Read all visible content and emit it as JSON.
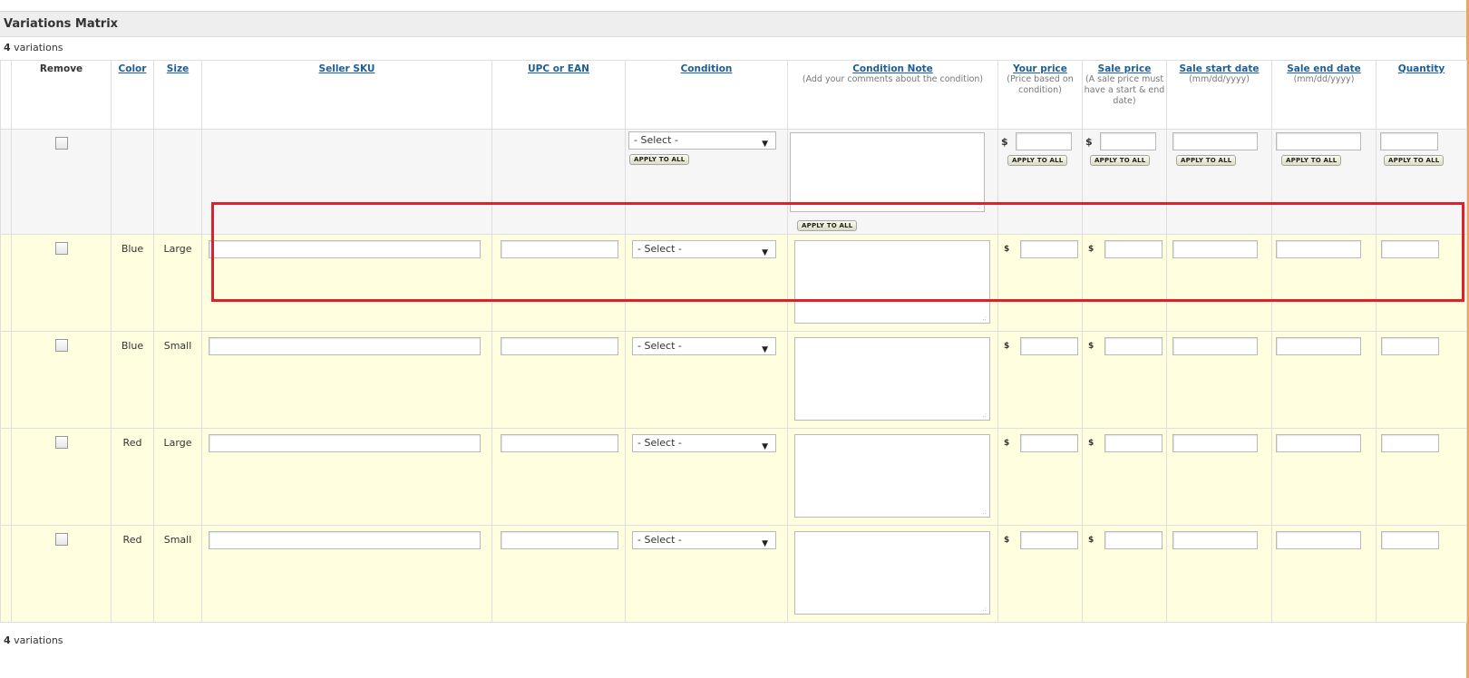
{
  "panel": {
    "title": "Variations Matrix"
  },
  "count": {
    "number": "4",
    "label": "variations"
  },
  "headers": {
    "remove": "Remove",
    "color": "Color",
    "size": "Size",
    "seller_sku": "Seller SKU",
    "upc": "UPC or EAN",
    "condition": "Condition",
    "condition_note": "Condition Note",
    "condition_note_sub": "(Add your comments about the condition)",
    "your_price": "Your price",
    "your_price_sub": "(Price based on condition)",
    "sale_price": "Sale price",
    "sale_price_sub": "(A sale price must have a start & end date)",
    "sale_start": "Sale start date",
    "sale_start_sub": "(mm/dd/yyyy)",
    "sale_end": "Sale end date",
    "sale_end_sub": "(mm/dd/yyyy)",
    "quantity": "Quantity"
  },
  "apply_row": {
    "select_value": "- Select -",
    "apply_label": "APPLY TO ALL",
    "currency": "$"
  },
  "rows": [
    {
      "color": "Blue",
      "size": "Large",
      "condition": "- Select -",
      "currency": "$"
    },
    {
      "color": "Blue",
      "size": "Small",
      "condition": "- Select -",
      "currency": "$"
    },
    {
      "color": "Red",
      "size": "Large",
      "condition": "- Select -",
      "currency": "$"
    },
    {
      "color": "Red",
      "size": "Small",
      "condition": "- Select -",
      "currency": "$"
    }
  ],
  "colors": {
    "highlight": "#e0202c",
    "row_bg": "#ffffe0",
    "link": "#1a5e9a"
  },
  "icons": {
    "dropdown": "chevron-down-icon",
    "resize": "resize-grip-icon"
  }
}
